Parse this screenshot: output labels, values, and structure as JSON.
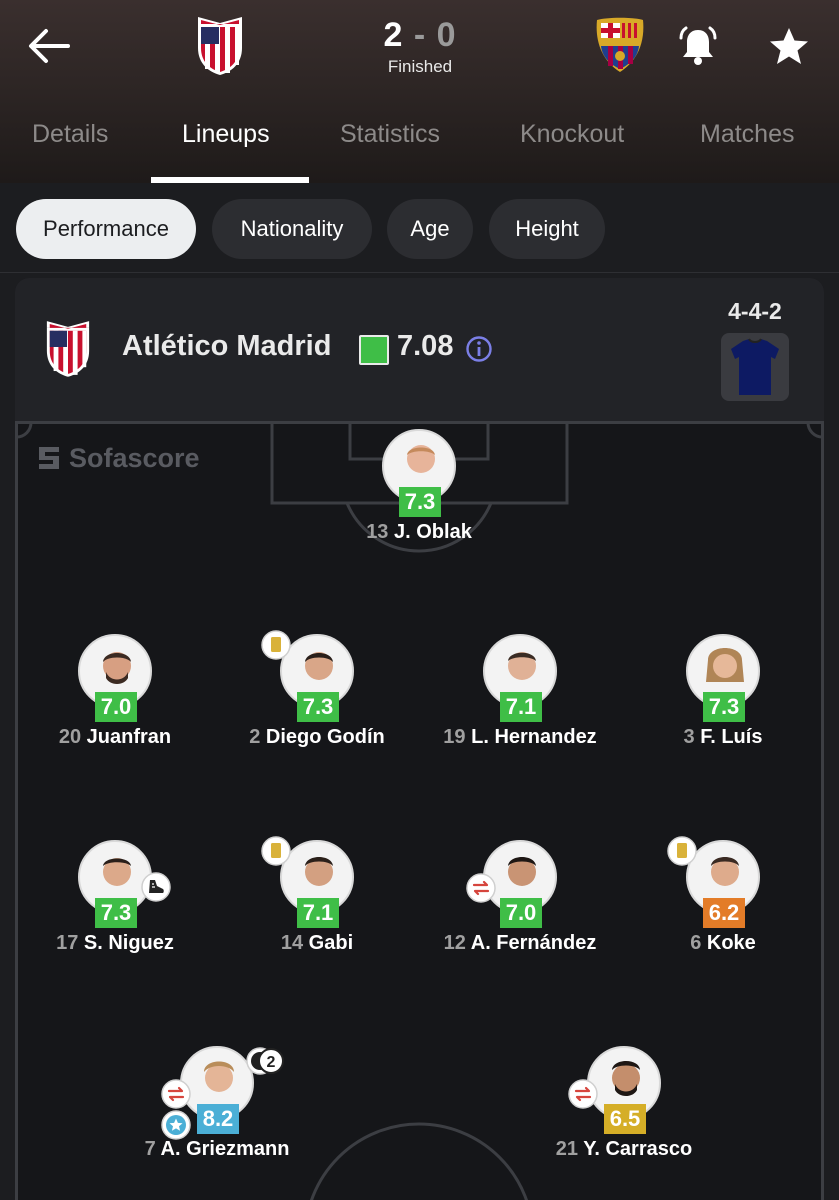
{
  "match": {
    "home_score": "2",
    "separator": "-",
    "away_score": "0",
    "status": "Finished",
    "home_crest": "atletico-madrid-crest",
    "away_crest": "fc-barcelona-crest"
  },
  "tabs": [
    {
      "label": "Details"
    },
    {
      "label": "Lineups"
    },
    {
      "label": "Statistics"
    },
    {
      "label": "Knockout"
    },
    {
      "label": "Matches"
    }
  ],
  "active_tab": "Lineups",
  "chips": [
    {
      "label": "Performance"
    },
    {
      "label": "Nationality"
    },
    {
      "label": "Age"
    },
    {
      "label": "Height"
    }
  ],
  "active_chip": "Performance",
  "team": {
    "name": "Atlético Madrid",
    "rating": "7.08",
    "formation": "4-4-2",
    "kit_color": "#0d1a63"
  },
  "brand": "Sofascore",
  "players": [
    {
      "number": "13",
      "name": "J. Oblak",
      "rating": "7.3",
      "rating_color": "green"
    },
    {
      "number": "20",
      "name": "Juanfran",
      "rating": "7.0",
      "rating_color": "green"
    },
    {
      "number": "2",
      "name": "Diego Godín",
      "rating": "7.3",
      "rating_color": "green"
    },
    {
      "number": "19",
      "name": "L. Hernandez",
      "rating": "7.1",
      "rating_color": "green"
    },
    {
      "number": "3",
      "name": "F. Luís",
      "rating": "7.3",
      "rating_color": "green"
    },
    {
      "number": "17",
      "name": "S. Niguez",
      "rating": "7.3",
      "rating_color": "green"
    },
    {
      "number": "14",
      "name": "Gabi",
      "rating": "7.1",
      "rating_color": "green"
    },
    {
      "number": "12",
      "name": "A. Fernández",
      "rating": "7.0",
      "rating_color": "green"
    },
    {
      "number": "6",
      "name": "Koke",
      "rating": "6.2",
      "rating_color": "orange"
    },
    {
      "number": "7",
      "name": "A. Griezmann",
      "rating": "8.2",
      "rating_color": "blue",
      "goals": "2"
    },
    {
      "number": "21",
      "name": "Y. Carrasco",
      "rating": "6.5",
      "rating_color": "yellow"
    }
  ],
  "colors": {
    "rating_green": "#3fbe47",
    "rating_orange": "#e37c28",
    "rating_yellow": "#d5ae27",
    "rating_blue": "#4bafd6",
    "yellow_card": "#d9b23a"
  }
}
